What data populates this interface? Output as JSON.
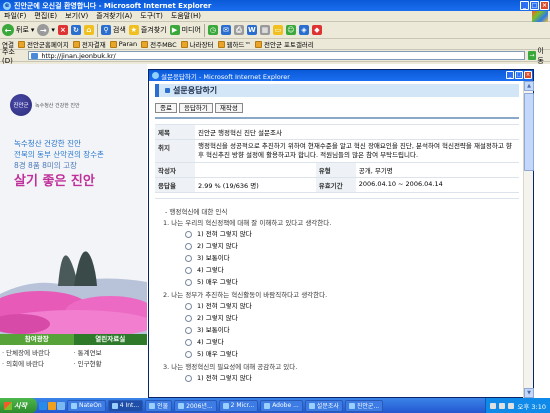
{
  "window": {
    "title": "진안군에 오신걸 환영합니다 - Microsoft Internet Explorer"
  },
  "menu": [
    "파일(F)",
    "편집(E)",
    "보기(V)",
    "즐겨찾기(A)",
    "도구(T)",
    "도움말(H)"
  ],
  "toolbar": {
    "back_label": "뒤로",
    "search_label": "검색",
    "favorites_label": "즐겨찾기",
    "media_label": "미디어"
  },
  "links": {
    "label": "연결",
    "items": [
      "전안군홈페이지",
      "전자결재",
      "Paran",
      "전주MBC",
      "나라장터",
      "웹하드™",
      "전안군 포토갤러리"
    ]
  },
  "address": {
    "label": "주소(D)",
    "url": "http://jinan.jeonbuk.kr/",
    "go_label": "이동"
  },
  "left_page": {
    "logo_text": "진안군",
    "logo_slogan": "녹수청산 건강한 진안",
    "hero_lines": [
      "녹수청산 건강한 진안",
      "전북의 동부 산악권의 장수촌",
      "8경 8품 8미의 고장"
    ],
    "hero_main": "살기 좋은 진안",
    "tab_a": "참여광장",
    "tab_b": "열린자료실",
    "list_a": [
      "· 단체장에 바란다",
      "· 의회에 바란다"
    ],
    "list_b": [
      "· 통계연보",
      "· 인구현황"
    ]
  },
  "popup": {
    "title": "설문응답하기 - Microsoft Internet Explorer",
    "header": "설문응답하기",
    "buttons": [
      "종료",
      "응답하기",
      "재작성"
    ],
    "info": {
      "title_label": "제목",
      "title_value": "진안군 행정혁신 진단 설문조사",
      "purpose_label": "취지",
      "purpose_value": "행정혁신을 성공적으로 추진하기 위하여 현재수준을 알고 혁신 장애요인을 진단, 분석하여 혁신전략을 재설정하고 향후 혁신추진 방향 설정에 활용하고자 합니다. 적원님들의 많은 참여 부탁드립니다.",
      "author_label": "작성자",
      "author_value": "",
      "type_label": "유형",
      "type_value": "공개, 무기명",
      "rate_label": "응답율",
      "rate_value": "2.99 % (19/636 명)",
      "period_label": "유효기간",
      "period_value": "2006.04.10 ~ 2006.04.14"
    },
    "section": "- 행정혁신에 대한 인식",
    "questions": [
      {
        "text": "1.  나는 우리의 혁신정책에 대해 잘 이해하고 있다고 생각한다.",
        "options": [
          "1)  전혀 그렇지 않다",
          "2)  그렇지 않다",
          "3)  보통이다",
          "4)  그렇다",
          "5)  매우 그렇다"
        ]
      },
      {
        "text": "2.  나는 정부가 추진하는 혁신활동이 바람직하다고 생각한다.",
        "options": [
          "1)  전혀 그렇지 않다",
          "2)  그렇지 않다",
          "3)  보통이다",
          "4)  그렇다",
          "5)  매우 그렇다"
        ]
      },
      {
        "text": "3.  나는 행정혁신의 필요성에 대해 공감하고 있다.",
        "options": [
          "1)  전혀 그렇지 않다"
        ]
      }
    ]
  },
  "taskbar": {
    "start": "시작",
    "tasks": [
      "NateOn",
      "4 Int...",
      "인물",
      "2006년...",
      "2 Micr...",
      "Adobe ...",
      "설문조사",
      "진안군..."
    ],
    "clock": "오후 3:10"
  },
  "colors": {
    "titlebar": "#0a5ad8",
    "accent_green": "#58a23a",
    "header_bg": "#d3e6f8",
    "hero_pink": "#c0309a"
  }
}
